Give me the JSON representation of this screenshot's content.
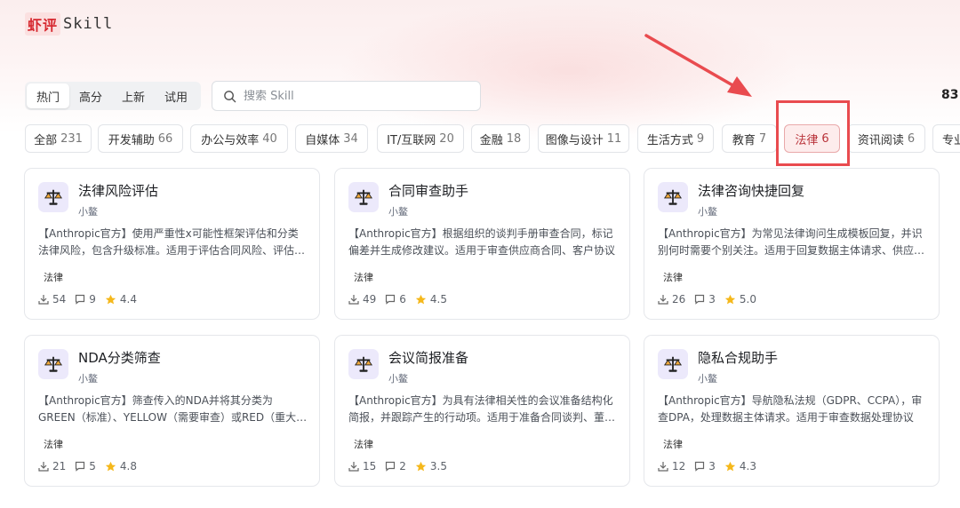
{
  "logo": {
    "cn": "虾评",
    "en": "Skill"
  },
  "sort_tabs": [
    {
      "label": "热门",
      "active": true
    },
    {
      "label": "高分",
      "active": false
    },
    {
      "label": "上新",
      "active": false
    },
    {
      "label": "试用",
      "active": false
    }
  ],
  "search": {
    "placeholder": "搜索 Skill",
    "value": ""
  },
  "count": "83",
  "categories": [
    {
      "label": "全部",
      "count": "231",
      "active": false
    },
    {
      "label": "开发辅助",
      "count": "66",
      "active": false
    },
    {
      "label": "办公与效率",
      "count": "40",
      "active": false
    },
    {
      "label": "自媒体",
      "count": "34",
      "active": false
    },
    {
      "label": "IT/互联网",
      "count": "20",
      "active": false
    },
    {
      "label": "金融",
      "count": "18",
      "active": false
    },
    {
      "label": "图像与设计",
      "count": "11",
      "active": false
    },
    {
      "label": "生活方式",
      "count": "9",
      "active": false
    },
    {
      "label": "教育",
      "count": "7",
      "active": false
    },
    {
      "label": "法律",
      "count": "6",
      "active": true
    },
    {
      "label": "资讯阅读",
      "count": "6",
      "active": false
    },
    {
      "label": "专业",
      "count": "",
      "active": false
    }
  ],
  "annotation": {
    "color": "#e94b4f"
  },
  "cards": [
    {
      "title": "法律风险评估",
      "author": "小鳌",
      "icon": "scales-icon",
      "desc": "【Anthropic官方】使用严重性x可能性框架评估和分类法律风险，包含升级标准。适用于评估合同风险、评估交易风险、分类法律问题",
      "tag": "法律",
      "downloads": "54",
      "comments": "9",
      "rating": "4.4"
    },
    {
      "title": "合同审查助手",
      "author": "小鳌",
      "icon": "scales-icon",
      "desc": "【Anthropic官方】根据组织的谈判手册审查合同，标记偏差并生成修改建议。适用于审查供应商合同、客户协议",
      "tag": "法律",
      "downloads": "49",
      "comments": "6",
      "rating": "4.5"
    },
    {
      "title": "法律咨询快捷回复",
      "author": "小鳌",
      "icon": "scales-icon",
      "desc": "【Anthropic官方】为常见法律询问生成模板回复，并识别何时需要个别关注。适用于回复数据主体请求、供应商问题",
      "tag": "法律",
      "downloads": "26",
      "comments": "3",
      "rating": "5.0"
    },
    {
      "title": "NDA分类筛查",
      "author": "小鳌",
      "icon": "scales-icon",
      "desc": "【Anthropic官方】筛查传入的NDA并将其分类为GREEN（标准）、YELLOW（需要审查）或RED（重大问题）",
      "tag": "法律",
      "downloads": "21",
      "comments": "5",
      "rating": "4.8"
    },
    {
      "title": "会议简报准备",
      "author": "小鳌",
      "icon": "scales-icon",
      "desc": "【Anthropic官方】为具有法律相关性的会议准备结构化简报，并跟踪产生的行动项。适用于准备合同谈判、董事会会议",
      "tag": "法律",
      "downloads": "15",
      "comments": "2",
      "rating": "3.5"
    },
    {
      "title": "隐私合规助手",
      "author": "小鳌",
      "icon": "scales-icon",
      "desc": "【Anthropic官方】导航隐私法规（GDPR、CCPA），审查DPA，处理数据主体请求。适用于审查数据处理协议",
      "tag": "法律",
      "downloads": "12",
      "comments": "3",
      "rating": "4.3"
    }
  ]
}
